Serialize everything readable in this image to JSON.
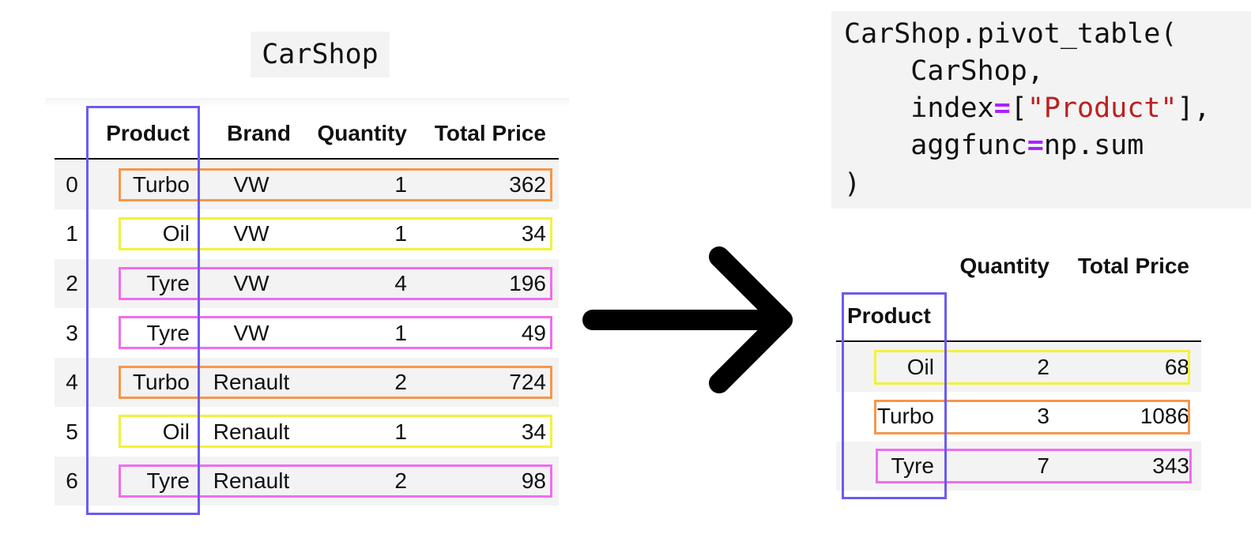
{
  "colors": {
    "index_box": "#6b5bf0",
    "turbo": "#f7964a",
    "oil": "#f2f23a",
    "tyre": "#f06cf0",
    "row_shade": "#f3f3f3",
    "code_operator": "#aa22ff",
    "code_string": "#ba2121"
  },
  "source_table": {
    "title": "CarShop",
    "columns": [
      "Product",
      "Brand",
      "Quantity",
      "Total Price"
    ],
    "rows": [
      {
        "index": "0",
        "product": "Turbo",
        "brand": "VW",
        "quantity": "1",
        "total_price": "362"
      },
      {
        "index": "1",
        "product": "Oil",
        "brand": "VW",
        "quantity": "1",
        "total_price": "34"
      },
      {
        "index": "2",
        "product": "Tyre",
        "brand": "VW",
        "quantity": "4",
        "total_price": "196"
      },
      {
        "index": "3",
        "product": "Tyre",
        "brand": "VW",
        "quantity": "1",
        "total_price": "49"
      },
      {
        "index": "4",
        "product": "Turbo",
        "brand": "Renault",
        "quantity": "2",
        "total_price": "724"
      },
      {
        "index": "5",
        "product": "Oil",
        "brand": "Renault",
        "quantity": "1",
        "total_price": "34"
      },
      {
        "index": "6",
        "product": "Tyre",
        "brand": "Renault",
        "quantity": "2",
        "total_price": "98"
      }
    ]
  },
  "code": {
    "line1": "CarShop.pivot_table(",
    "line2": "    CarShop,",
    "line3_kw": "    index",
    "line3_eq": "=",
    "line3_open": "[",
    "line3_str": "\"Product\"",
    "line3_close": "],",
    "line4_kw": "    aggfunc",
    "line4_eq": "=",
    "line4_val": "np.sum",
    "line5": ")"
  },
  "result_table": {
    "columns": [
      "Quantity",
      "Total Price"
    ],
    "index_name": "Product",
    "rows": [
      {
        "product": "Oil",
        "quantity": "2",
        "total_price": "68"
      },
      {
        "product": "Turbo",
        "quantity": "3",
        "total_price": "1086"
      },
      {
        "product": "Tyre",
        "quantity": "7",
        "total_price": "343"
      }
    ]
  }
}
